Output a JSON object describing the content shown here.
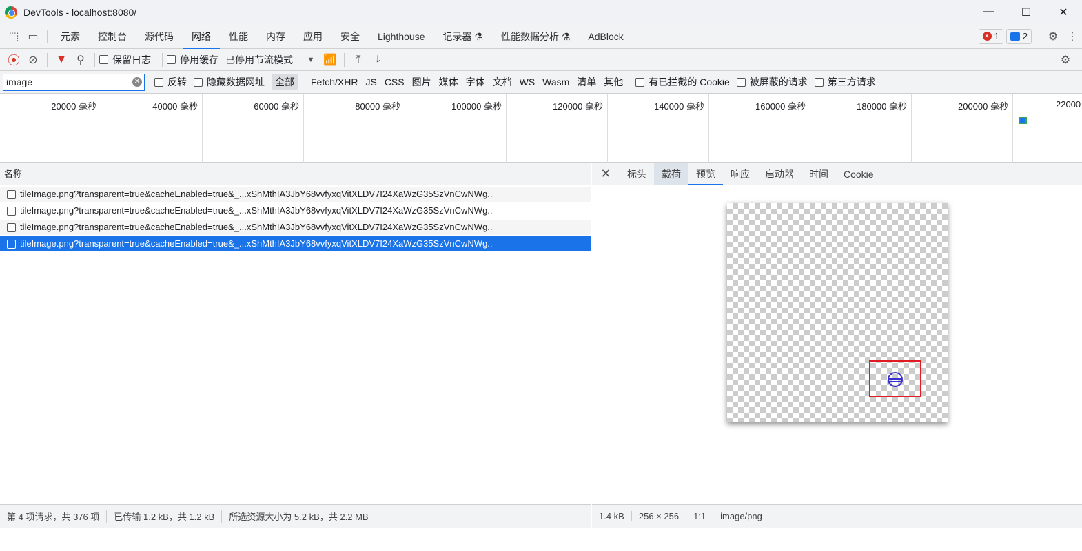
{
  "window": {
    "title": "DevTools - localhost:8080/",
    "controls": [
      "—",
      "☐",
      "✕"
    ]
  },
  "tabs": [
    "元素",
    "控制台",
    "源代码",
    "网络",
    "性能",
    "内存",
    "应用",
    "安全",
    "Lighthouse",
    "记录器 ⚗",
    "性能数据分析 ⚗",
    "AdBlock"
  ],
  "active_tab": "网络",
  "badges": {
    "errors": "1",
    "messages": "2"
  },
  "toolbar": {
    "preserve_log": "保留日志",
    "disable_cache": "停用缓存",
    "throttling": "已停用节流模式"
  },
  "filter": {
    "value": "image",
    "invert": "反转",
    "hide_data_urls": "隐藏数据网址",
    "types": [
      "全部",
      "Fetch/XHR",
      "JS",
      "CSS",
      "图片",
      "媒体",
      "字体",
      "文档",
      "WS",
      "Wasm",
      "清单",
      "其他"
    ],
    "blocked_cookies": "有已拦截的 Cookie",
    "blocked_requests": "被屏蔽的请求",
    "third_party": "第三方请求"
  },
  "timeline": {
    "ticks": [
      "20000 毫秒",
      "40000 毫秒",
      "60000 毫秒",
      "80000 毫秒",
      "100000 毫秒",
      "120000 毫秒",
      "140000 毫秒",
      "160000 毫秒",
      "180000 毫秒",
      "200000 毫秒",
      "22000"
    ]
  },
  "requests": {
    "header": "名称",
    "rows": [
      "tileImage.png?transparent=true&cacheEnabled=true&_...xShMthIA3JbY68vvfyxqVitXLDV7I24XaWzG35SzVnCwNWg..",
      "tileImage.png?transparent=true&cacheEnabled=true&_...xShMthIA3JbY68vvfyxqVitXLDV7I24XaWzG35SzVnCwNWg..",
      "tileImage.png?transparent=true&cacheEnabled=true&_...xShMthIA3JbY68vvfyxqVitXLDV7I24XaWzG35SzVnCwNWg..",
      "tileImage.png?transparent=true&cacheEnabled=true&_...xShMthIA3JbY68vvfyxqVitXLDV7I24XaWzG35SzVnCwNWg.."
    ],
    "selected_index": 3
  },
  "detail_tabs": [
    "标头",
    "载荷",
    "预览",
    "响应",
    "启动器",
    "时间",
    "Cookie"
  ],
  "active_detail_tab": "预览",
  "status_left": [
    "第 4 项请求，共 376 项",
    "已传输 1.2 kB，共 1.2 kB",
    "所选资源大小为 5.2 kB，共 2.2 MB"
  ],
  "status_right": [
    "1.4 kB",
    "256 × 256",
    "1:1",
    "image/png"
  ]
}
